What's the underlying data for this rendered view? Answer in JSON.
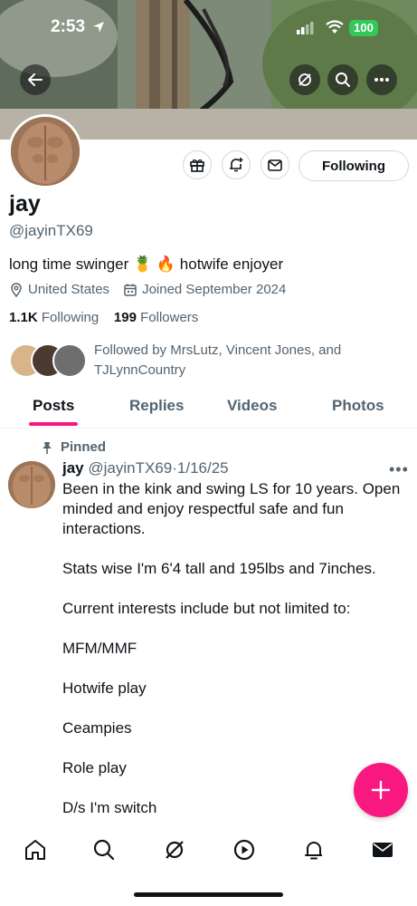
{
  "status_bar": {
    "time": "2:53",
    "battery": "100"
  },
  "profile": {
    "name": "jay",
    "handle": "@jayinTX69",
    "bio": "long time swinger 🍍 🔥 hotwife enjoyer",
    "location": "United States",
    "joined": "Joined September 2024",
    "following_count": "1.1K",
    "following_label": "Following",
    "followers_count": "199",
    "followers_label": "Followers",
    "followed_by": "Followed by MrsLutz, Vincent Jones, and TJLynnCountry",
    "follow_button": "Following"
  },
  "tabs": [
    {
      "label": "Posts",
      "active": true
    },
    {
      "label": "Replies",
      "active": false
    },
    {
      "label": "Videos",
      "active": false
    },
    {
      "label": "Photos",
      "active": false
    }
  ],
  "post": {
    "pinned_label": "Pinned",
    "author": "jay",
    "handle": "@jayinTX69",
    "separator": "·",
    "date": "1/16/25",
    "more": "•••",
    "paragraphs": [
      "Been in the kink and swing LS for 10 years. Open minded and enjoy respectful safe and fun interactions.",
      "Stats wise I'm 6'4 tall and 195lbs and 7inches.",
      "Current interests include but not limited to:",
      "MFM/MMF",
      "Hotwife play",
      "Ceampies",
      "Role play",
      "D/s I'm switch"
    ]
  },
  "colors": {
    "accent": "#f91880",
    "text": "#0f1419",
    "secondary": "#536471",
    "border": "#cfd9de"
  },
  "icons": {
    "top": [
      "back-arrow-icon",
      "grok-icon",
      "search-icon",
      "more-icon"
    ],
    "actions": [
      "gift-icon",
      "notification-bell-add-icon",
      "mail-icon"
    ],
    "nav": [
      "home-icon",
      "search-icon",
      "grok-icon",
      "video-play-icon",
      "bell-icon",
      "mail-icon"
    ],
    "fab": "plus-icon"
  }
}
